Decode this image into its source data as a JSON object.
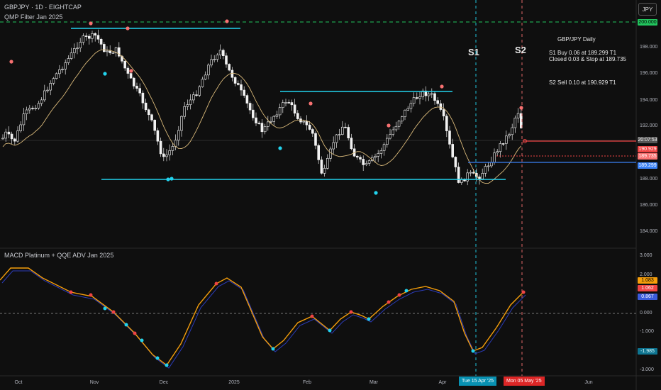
{
  "header": {
    "symbol_line": "GBPJPY · 1D · EIGHTCAP",
    "indicator_label": "QMP Filter Jan 2025",
    "currency": "JPY"
  },
  "macd_label": "MACD Platinum + QQE ADV Jan 2025",
  "annotations": {
    "title": "GBP/JPY Daily",
    "s1_line1": "S1 Buy 0.06 at 189.299 T1",
    "s1_line2": "Closed 0.03 & Stop at 189.735",
    "s2_line1": "S2 Sell 0.10 at 190.929 T1",
    "s1_marker": "S1",
    "s2_marker": "S2"
  },
  "price_axis": {
    "ticks": [
      "200.000",
      "198.000",
      "196.000",
      "194.000",
      "192.000",
      "188.000",
      "186.000",
      "184.000"
    ],
    "badges": {
      "top": "200.000",
      "countdown": "20:07:53",
      "sell": "190.929",
      "stop": "189.735",
      "buy": "189.299"
    }
  },
  "macd_axis": {
    "ticks": [
      "3.000",
      "-1.000",
      "0.000",
      "-3.000"
    ],
    "badges": {
      "a": "1.083",
      "b": "1.062",
      "c": "0.867",
      "d": "-1.985",
      "e": "2.000"
    }
  },
  "time_axis": {
    "labels": [
      "Oct",
      "Nov",
      "Dec",
      "2025",
      "Feb",
      "Mar",
      "Apr",
      "Jun"
    ],
    "s1_date": "Tue 15 Apr '25",
    "s2_date": "Mon 05 May '25"
  },
  "colors": {
    "background": "#0f0f0f",
    "candle": "#ffffff",
    "ma": "#d9b97a",
    "cyan": "#22d3ee",
    "red_dot": "#f87171",
    "green_dash": "#22c55e",
    "macd_orange": "#f59e0b",
    "macd_blue": "#2b3bb8"
  }
}
